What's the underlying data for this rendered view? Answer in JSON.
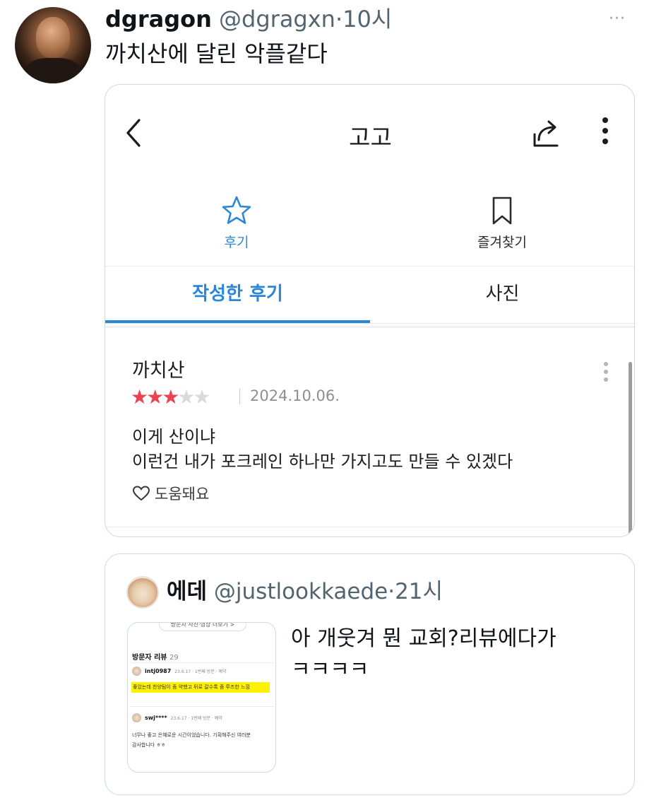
{
  "tweet": {
    "display_name": "dgragon",
    "handle": "@dgragxn",
    "separator": "·",
    "time": "10시",
    "more": "···",
    "text": "까치산에 달린 악플같다"
  },
  "embedded_screenshot": {
    "nav": {
      "title": "고고"
    },
    "actions": {
      "review_label": "후기",
      "favorites_label": "즐겨찾기"
    },
    "tabs": {
      "written_reviews": "작성한 후기",
      "photos": "사진"
    },
    "review": {
      "place_name": "까치산",
      "rating": 3,
      "rating_max": 5,
      "date": "2024.10.06.",
      "lines": [
        "이게 산이냐",
        "이런건 내가 포크레인 하나만 가지고도 만들 수 있겠다"
      ],
      "helpful_label": "도움돼요"
    },
    "colors": {
      "accent": "#2a87d8",
      "star_filled": "#ee4253",
      "star_empty": "#dadada"
    }
  },
  "quote_tweet": {
    "display_name": "에데",
    "handle": "@justlookkaede",
    "separator": "·",
    "time": "21시",
    "text_line1": "아 개웃겨 뭔 교회?리뷰에다가",
    "text_line2": "ㅋㅋㅋㅋ",
    "thumbnail": {
      "pill": "방문자 사진·영상 더보기 >",
      "section_title": "방문자 리뷰",
      "section_count": "29",
      "review1": {
        "user": "intj0987",
        "meta": "23.6.17 · 1번째 방문 · 예약",
        "text": "좋았는데 찬양팀이 좀 약했고 뒤로 갈수록 좀 루즈한 느낌"
      },
      "review2": {
        "user": "swj****",
        "meta": "23.6.17 · 1번째 방문 · 예약",
        "text_line1": "너무나 좋고 은혜로운 시간이었습니다. 기획해주신 여러분",
        "text_line2": "감사합니다 ㅎㅎ"
      }
    }
  }
}
